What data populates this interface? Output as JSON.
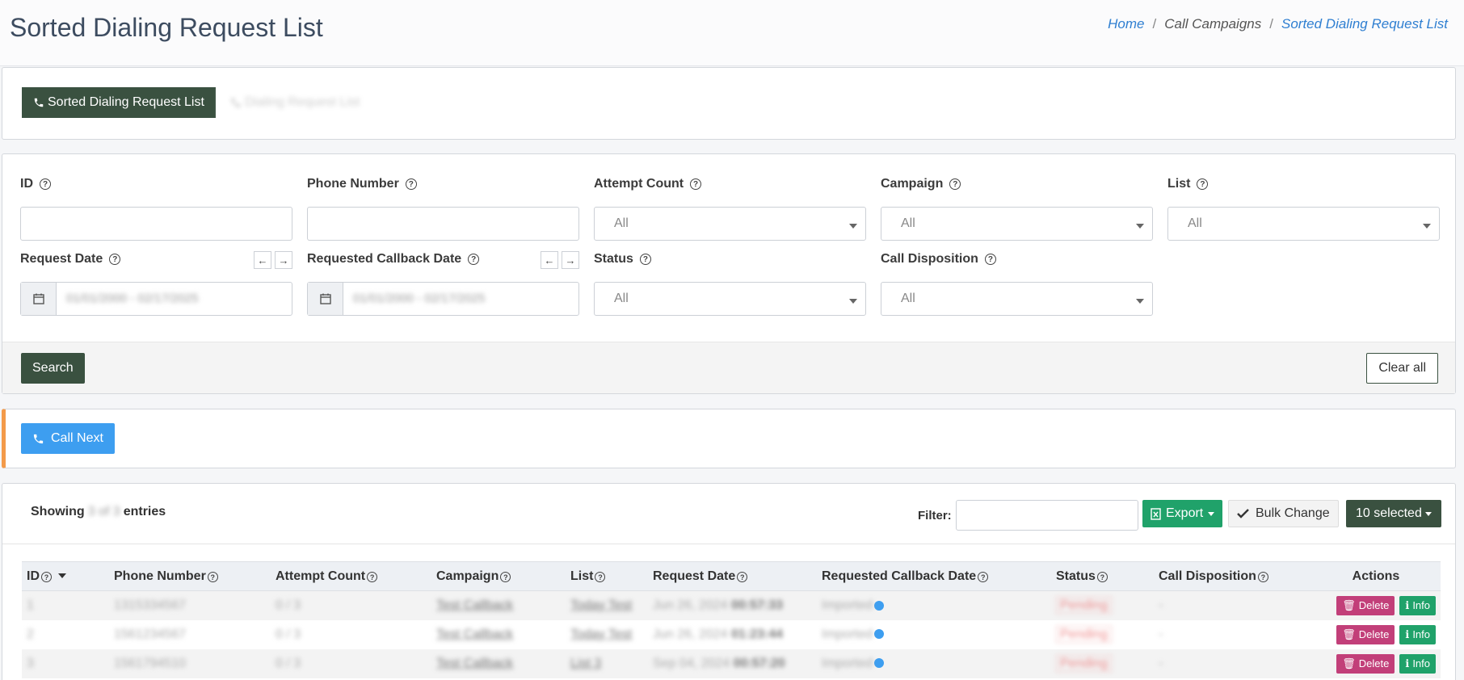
{
  "header": {
    "title": "Sorted Dialing Request List",
    "breadcrumb": [
      "Home",
      "Call Campaigns",
      "Sorted Dialing Request List"
    ]
  },
  "tabs": {
    "active": "Sorted Dialing Request List",
    "inactive": "Dialing Request List"
  },
  "filters": {
    "id_label": "ID",
    "phone_label": "Phone Number",
    "attempt_label": "Attempt Count",
    "campaign_label": "Campaign",
    "list_label": "List",
    "request_date_label": "Request Date",
    "callback_date_label": "Requested Callback Date",
    "status_label": "Status",
    "disposition_label": "Call Disposition",
    "select_default": "All",
    "request_date_value": "01/01/2000 - 02/17/2025",
    "callback_date_value": "01/01/2000 - 02/17/2025",
    "search_label": "Search",
    "clear_label": "Clear all"
  },
  "call_next": {
    "label": "Call Next"
  },
  "table_toolbar": {
    "showing_prefix": "Showing",
    "showing_count": "3 of 3",
    "showing_suffix": "entries",
    "filter_label": "Filter:",
    "export_label": "Export",
    "bulk_label": "Bulk Change",
    "selected_label": "10 selected"
  },
  "table": {
    "columns": [
      "ID",
      "Phone Number",
      "Attempt Count",
      "Campaign",
      "List",
      "Request Date",
      "Requested Callback Date",
      "Status",
      "Call Disposition",
      "Actions"
    ],
    "rows": [
      {
        "id": "1",
        "phone": "1315334567",
        "attempts": "0 / 3",
        "campaign": "Test Callback",
        "list": "Today Test",
        "date": "Jun 26, 2024",
        "time": "00:57:33",
        "callback": "Imported",
        "status": "Pending",
        "disposition": "-"
      },
      {
        "id": "2",
        "phone": "1561234567",
        "attempts": "0 / 3",
        "campaign": "Test Callback",
        "list": "Today Test",
        "date": "Jun 26, 2024",
        "time": "01:23:44",
        "callback": "Imported",
        "status": "Pending",
        "disposition": "-"
      },
      {
        "id": "3",
        "phone": "1561794510",
        "attempts": "0 / 3",
        "campaign": "Test Callback",
        "list": "List 3",
        "date": "Sep 04, 2024",
        "time": "00:57:20",
        "callback": "Imported",
        "status": "Pending",
        "disposition": "-"
      }
    ],
    "delete_label": "Delete",
    "info_label": "Info"
  },
  "colors": {
    "primary_dark": "#3a5140",
    "accent_blue": "#3d9ef0",
    "export_green": "#20a26a",
    "delete_pink": "#c23f79",
    "callnext_border": "#f39a4a"
  },
  "icons": [
    "phone-icon",
    "help-icon",
    "calendar-icon",
    "arrow-left-icon",
    "arrow-right-icon",
    "excel-icon",
    "check-icon",
    "trash-icon",
    "info-icon"
  ]
}
